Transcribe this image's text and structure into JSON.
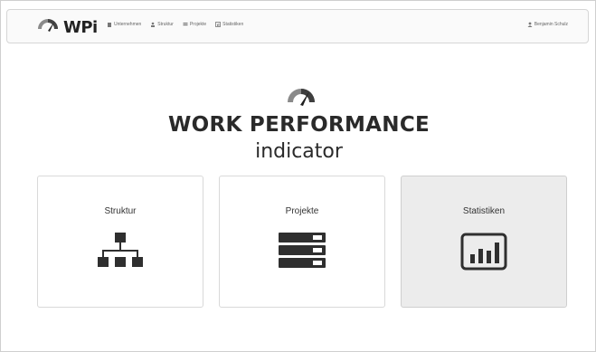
{
  "header": {
    "brand": "WPi",
    "nav": [
      {
        "label": "Unternehmen",
        "icon": "building-icon"
      },
      {
        "label": "Struktur",
        "icon": "user-tree-icon"
      },
      {
        "label": "Projekte",
        "icon": "grid-icon"
      },
      {
        "label": "Statistiken",
        "icon": "chart-icon"
      }
    ],
    "user": {
      "label": "Benjamin Schulz",
      "icon": "user-icon"
    }
  },
  "hero": {
    "title": "WORK PERFORMANCE",
    "subtitle": "indicator"
  },
  "cards": [
    {
      "label": "Struktur",
      "icon": "org-chart-icon"
    },
    {
      "label": "Projekte",
      "icon": "server-list-icon"
    },
    {
      "label": "Statistiken",
      "icon": "bar-chart-icon"
    }
  ]
}
